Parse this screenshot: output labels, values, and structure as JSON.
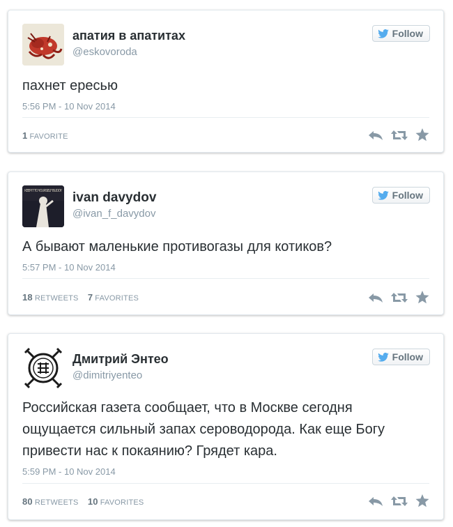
{
  "colors": {
    "accent": "#55acee",
    "text": "#292f33",
    "muted": "#8899a6",
    "icon": "#8899a6"
  },
  "tweets": [
    {
      "display_name": "апатия в апатитах",
      "handle": "@eskovoroda",
      "follow_label": "Follow",
      "text": "пахнет ересью",
      "timestamp": "5:56 PM - 10 Nov 2014",
      "favorites_count": "1",
      "favorites_label": "FAVORITE"
    },
    {
      "display_name": "ivan davydov",
      "handle": "@ivan_f_davydov",
      "follow_label": "Follow",
      "text": "А бывают маленькие противогазы для котиков?",
      "timestamp": "5:57 PM - 10 Nov 2014",
      "retweets_count": "18",
      "retweets_label": "RETWEETS",
      "favorites_count": "7",
      "favorites_label": "FAVORITES",
      "avatar_caption": "KEEP IT TO YOURSELF BUDDY"
    },
    {
      "display_name": "Дмитрий Энтео",
      "handle": "@dimitriyenteo",
      "follow_label": "Follow",
      "text": "Российская газета сообщает, что в Москве сегодня ощущается сильный запах сероводорода. Как еще Богу привести нас к покаянию? Грядет кара.",
      "timestamp": "5:59 PM - 10 Nov 2014",
      "retweets_count": "80",
      "retweets_label": "RETWEETS",
      "favorites_count": "10",
      "favorites_label": "FAVORITES"
    }
  ]
}
